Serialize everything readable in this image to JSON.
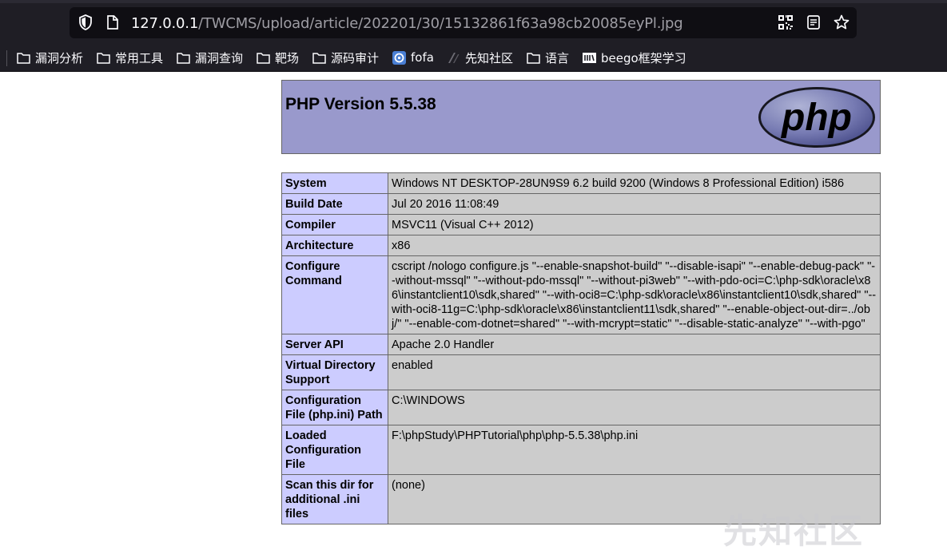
{
  "browser": {
    "url_host": "127.0.0.1",
    "url_path": "/TWCMS/upload/article/202201/30/15132861f63a98cb20085eyPl.jpg",
    "icons": [
      "shield-icon",
      "page-icon",
      "qr-code-icon",
      "reader-view-icon",
      "star-bookmark-icon"
    ]
  },
  "bookmarks": [
    {
      "label": "漏洞分析",
      "icon": "folder-icon"
    },
    {
      "label": "常用工具",
      "icon": "folder-icon"
    },
    {
      "label": "漏洞查询",
      "icon": "folder-icon"
    },
    {
      "label": "靶场",
      "icon": "folder-icon"
    },
    {
      "label": "源码审计",
      "icon": "folder-icon"
    },
    {
      "label": "fofa",
      "icon": "fofa-icon"
    },
    {
      "label": "先知社区",
      "icon": "xianzhi-icon"
    },
    {
      "label": "语言",
      "icon": "folder-icon"
    },
    {
      "label": "beego框架学习",
      "icon": "beego-icon"
    }
  ],
  "phpinfo": {
    "title": "PHP Version 5.5.38",
    "logo_text": "php",
    "colors": {
      "header": "#9999cc",
      "key": "#ccccff",
      "value": "#cccccc"
    },
    "rows": [
      {
        "key": "System",
        "value": "Windows NT DESKTOP-28UN9S9 6.2 build 9200 (Windows 8 Professional Edition) i586"
      },
      {
        "key": "Build Date",
        "value": "Jul 20 2016 11:08:49"
      },
      {
        "key": "Compiler",
        "value": "MSVC11 (Visual C++ 2012)"
      },
      {
        "key": "Architecture",
        "value": "x86"
      },
      {
        "key": "Configure Command",
        "value": "cscript /nologo configure.js \"--enable-snapshot-build\" \"--disable-isapi\" \"--enable-debug-pack\" \"--without-mssql\" \"--without-pdo-mssql\" \"--without-pi3web\" \"--with-pdo-oci=C:\\php-sdk\\oracle\\x86\\instantclient10\\sdk,shared\" \"--with-oci8=C:\\php-sdk\\oracle\\x86\\instantclient10\\sdk,shared\" \"--with-oci8-11g=C:\\php-sdk\\oracle\\x86\\instantclient11\\sdk,shared\" \"--enable-object-out-dir=../obj/\" \"--enable-com-dotnet=shared\" \"--with-mcrypt=static\" \"--disable-static-analyze\" \"--with-pgo\""
      },
      {
        "key": "Server API",
        "value": "Apache 2.0 Handler"
      },
      {
        "key": "Virtual Directory Support",
        "value": "enabled"
      },
      {
        "key": "Configuration File (php.ini) Path",
        "value": "C:\\WINDOWS"
      },
      {
        "key": "Loaded Configuration File",
        "value": "F:\\phpStudy\\PHPTutorial\\php\\php-5.5.38\\php.ini"
      },
      {
        "key": "Scan this dir for additional .ini files",
        "value": "(none)"
      }
    ]
  },
  "watermark": "先知社区"
}
